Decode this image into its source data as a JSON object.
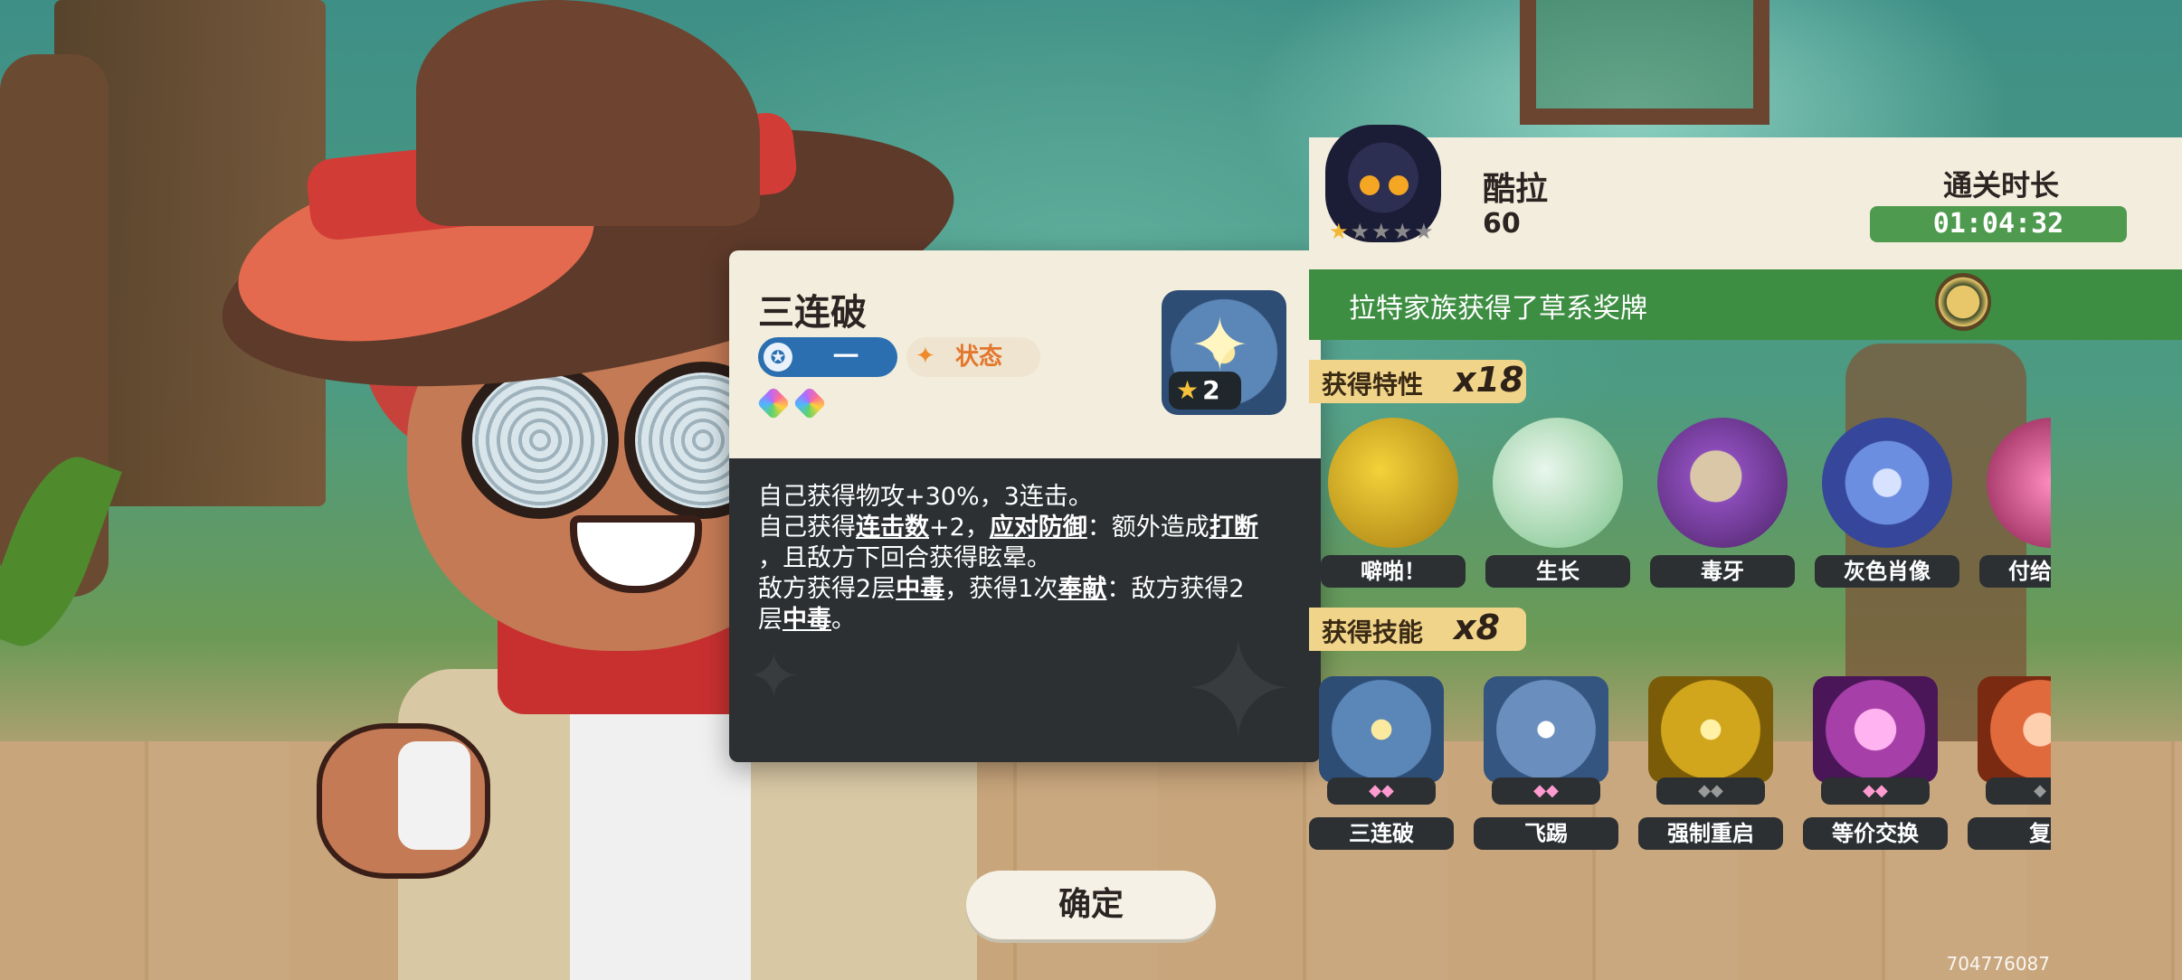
{
  "skill_popup": {
    "title": "三连破",
    "type_pill": "一",
    "state_label": "状态",
    "level": "2",
    "description_lines": [
      "自己获得物攻+30%，3连击。",
      "自己获得连击数+2，应对防御：额外造成打断",
      "，且敌方下回合获得眩晕。",
      "敌方获得2层中毒，获得1次奉献：敌方获得2",
      "层中毒。"
    ]
  },
  "confirm_label": "确定",
  "result": {
    "player_name": "酷拉",
    "player_level": "60",
    "player_stars": 1,
    "time_label": "通关时长",
    "time_value": "01:04:32",
    "medal_text": "拉特家族获得了草系奖牌"
  },
  "traits_section": {
    "label": "获得特性",
    "count": "x18",
    "items": [
      {
        "name": "噼啪！",
        "icon": "lightning-trait-icon",
        "color": "#c9a21a"
      },
      {
        "name": "生长",
        "icon": "leaf-growth-trait-icon",
        "color": "#a7dcb1"
      },
      {
        "name": "毒牙",
        "icon": "poison-fang-trait-icon",
        "color": "#7a3fa0"
      },
      {
        "name": "灰色肖像",
        "icon": "gray-portrait-trait-icon",
        "color": "#4e6fc4"
      },
      {
        "name": "付给恶魔",
        "icon": "demon-pay-trait-icon",
        "color": "#c0386a"
      }
    ]
  },
  "skills_section": {
    "label": "获得技能",
    "count": "x8",
    "items": [
      {
        "name": "三连破",
        "icon": "triple-break-skill-icon",
        "color": "#5a86b8",
        "gems": "◆◆",
        "lit": true
      },
      {
        "name": "飞踢",
        "icon": "flying-kick-skill-icon",
        "color": "#6a8fbf",
        "gems": "◆◆",
        "lit": true
      },
      {
        "name": "强制重启",
        "icon": "force-restart-skill-icon",
        "color": "#d1a51c",
        "gems": "◆◆",
        "lit": false
      },
      {
        "name": "等价交换",
        "icon": "equivalent-exchange-skill-icon",
        "color": "#a63fa8",
        "gems": "◆◆",
        "lit": true
      },
      {
        "name": "复",
        "icon": "revive-skill-icon",
        "color": "#e06a3c",
        "gems": "◆",
        "lit": false
      }
    ]
  },
  "uid": "704776087"
}
